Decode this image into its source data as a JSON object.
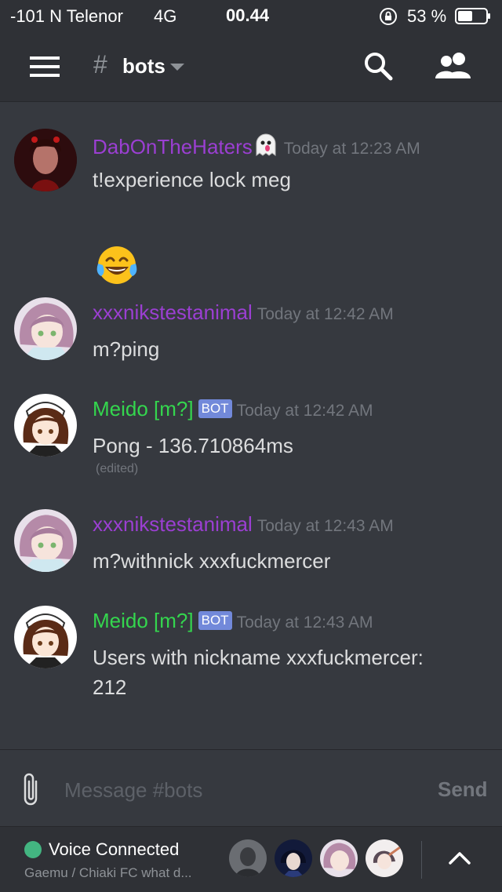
{
  "status_bar": {
    "carrier": "-101 N Telenor",
    "network": "4G",
    "time": "00.44",
    "battery": "53 %",
    "battery_level": 0.53
  },
  "header": {
    "channel_hash": "#",
    "channel_name": "bots"
  },
  "messages": [
    {
      "author": "DabOnTheHaters",
      "author_color": "#9b3fd2",
      "timestamp": "Today at 12:23 AM",
      "text": "t!experience lock meg",
      "emoji": "face-with-tears-of-joy-emoji"
    },
    {
      "author": "xxxnikstestanimal",
      "author_color": "#9b3fd2",
      "timestamp": "Today at 12:42 AM",
      "text": "m?ping"
    },
    {
      "author": "Meido [m?]",
      "author_color": "#34d64e",
      "bot_tag": "BOT",
      "timestamp": "Today at 12:42 AM",
      "text": "Pong - 136.710864ms",
      "edited": "(edited)"
    },
    {
      "author": "xxxnikstestanimal",
      "author_color": "#9b3fd2",
      "timestamp": "Today at 12:43 AM",
      "text": "m?withnick xxxfuckmercer"
    },
    {
      "author": "Meido [m?]",
      "author_color": "#34d64e",
      "bot_tag": "BOT",
      "timestamp": "Today at 12:43 AM",
      "text_line1": "Users with nickname xxxfuckmercer:",
      "text_line2": "212"
    }
  ],
  "input": {
    "placeholder": "Message #bots",
    "send_label": "Send"
  },
  "voice": {
    "title": "Voice Connected",
    "subtitle": "Gaemu / Chiaki FC what d...",
    "status_color": "#43b581"
  },
  "icons": [
    "menu-icon",
    "chevron-down-icon",
    "search-icon",
    "members-icon",
    "ghost-emoji",
    "paperclip-icon",
    "chevron-up-icon"
  ],
  "colors": {
    "background": "#36393f",
    "bars": "#2f3136",
    "bot_tag": "#7289da",
    "timestamp": "#72767d"
  }
}
